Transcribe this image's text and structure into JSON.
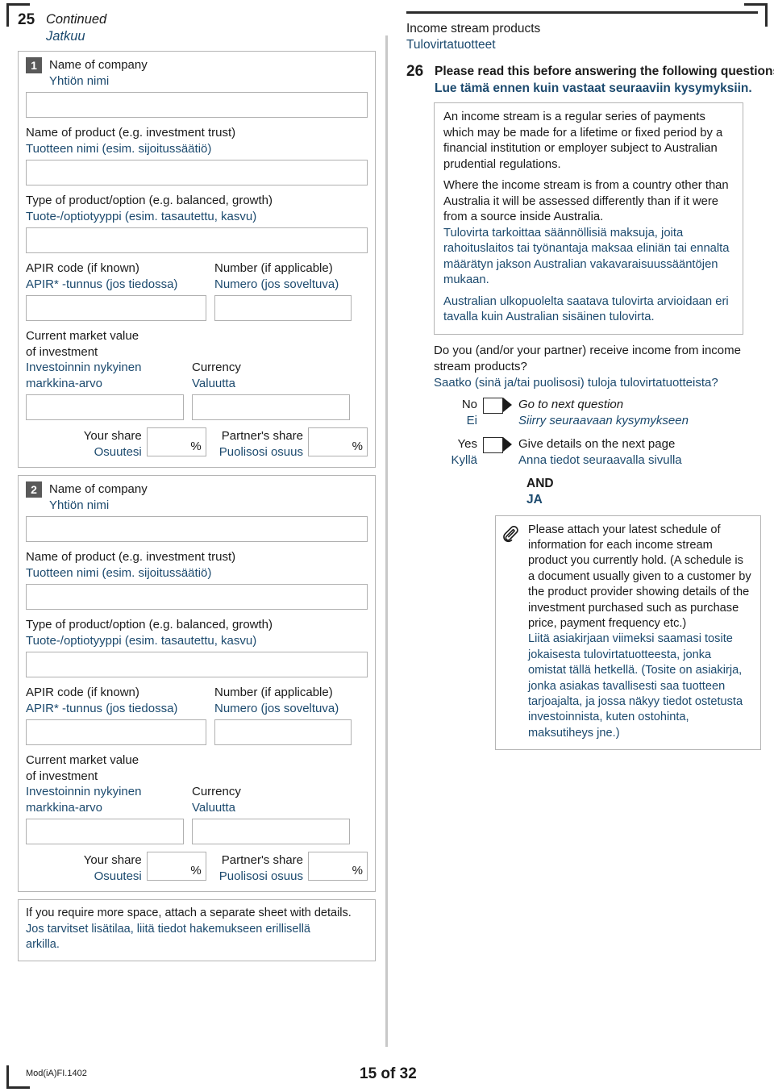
{
  "document": {
    "form_code": "Mod(iA)FI.1402",
    "page_label": "15 of 32",
    "colors": {
      "finnish_text": "#1c4a6e",
      "english_text": "#1a1a1a",
      "badge": "#595959"
    }
  },
  "left_column": {
    "question_number": "25",
    "heading_en": "Continued",
    "heading_fi": "Jatkuu",
    "blocks": [
      {
        "badge": "1",
        "company_en": "Name of company",
        "company_fi": "Yhtiön nimi",
        "product_en": "Name of product (e.g. investment trust)",
        "product_fi": "Tuotteen nimi (esim. sijoitussäätiö)",
        "type_en": "Type of product/option (e.g. balanced, growth)",
        "type_fi": "Tuote-/optiotyyppi (esim. tasautettu, kasvu)",
        "apir_en": "APIR code (if known)",
        "apir_fi": "APIR* -tunnus (jos tiedossa)",
        "number_en": "Number (if applicable)",
        "number_fi": "Numero (jos soveltuva)",
        "value_en_1": "Current market value",
        "value_en_2": "of investment",
        "value_fi_1": "Investoinnin nykyinen",
        "value_fi_2": "markkina-arvo",
        "currency_en": "Currency",
        "currency_fi": "Valuutta",
        "your_share_en": "Your share",
        "your_share_fi": "Osuutesi",
        "partner_share_en": "Partner's share",
        "partner_share_fi": "Puolisosi osuus",
        "percent_symbol": "%"
      },
      {
        "badge": "2",
        "company_en": "Name of company",
        "company_fi": "Yhtiön nimi",
        "product_en": "Name of product (e.g. investment trust)",
        "product_fi": "Tuotteen nimi (esim. sijoitussäätiö)",
        "type_en": "Type of product/option (e.g. balanced, growth)",
        "type_fi": "Tuote-/optiotyyppi (esim. tasautettu, kasvu)",
        "apir_en": "APIR code (if known)",
        "apir_fi": "APIR* -tunnus (jos tiedossa)",
        "number_en": "Number (if applicable)",
        "number_fi": "Numero (jos soveltuva)",
        "value_en_1": "Current market value",
        "value_en_2": "of investment",
        "value_fi_1": "Investoinnin nykyinen",
        "value_fi_2": "markkina-arvo",
        "currency_en": "Currency",
        "currency_fi": "Valuutta",
        "your_share_en": "Your share",
        "your_share_fi": "Osuutesi",
        "partner_share_en": "Partner's share",
        "partner_share_fi": "Puolisosi osuus",
        "percent_symbol": "%"
      }
    ],
    "more_space_note": {
      "en": "If you require more space, attach a separate sheet with details.",
      "fi_line1": "Jos tarvitset lisätilaa, liitä tiedot hakemukseen erillisellä",
      "fi_line2": "arkilla."
    }
  },
  "right_column": {
    "section_title_en": "Income stream products",
    "section_title_fi": "Tulovirtatuotteet",
    "question_number": "26",
    "question_en": "Please read this before answering the following questions.",
    "question_fi": "Lue tämä ennen kuin vastaat seuraaviin kysymyksiin.",
    "info_paragraphs": [
      {
        "lang": "en",
        "text": "An income stream is a regular series of payments which may be made for a lifetime or fixed period by a financial institution or employer subject to Australian prudential regulations."
      },
      {
        "lang": "en",
        "text": "Where the income stream is from a country other than Australia it will be assessed differently than if it were from a source inside Australia."
      },
      {
        "lang": "fi",
        "text": "Tulovirta tarkoittaa säännöllisiä maksuja, joita rahoituslaitos tai työnantaja maksaa eliniän tai ennalta määrätyn jakson Australian vakavaraisuussääntöjen mukaan."
      },
      {
        "lang": "fi",
        "text": "Australian ulkopuolelta saatava tulovirta arvioidaan eri tavalla kuin Australian sisäinen tulovirta."
      }
    ],
    "main_question_en_line1": "Do you (and/or your partner) receive income from income",
    "main_question_en_line2": "stream products?",
    "main_question_fi": "Saatko (sinä ja/tai puolisosi) tuloja tulovirtatuotteista?",
    "answers": [
      {
        "label_en": "No",
        "label_fi": "Ei",
        "action_en": "Go to next question",
        "action_fi": "Siirry seuraavaan kysymykseen",
        "italic": true
      },
      {
        "label_en": "Yes",
        "label_fi": "Kyllä",
        "action_en": "Give details on the next page",
        "action_fi": "Anna tiedot seuraavalla sivulla",
        "italic": false
      }
    ],
    "and_en": "AND",
    "and_fi": "JA",
    "attachment": {
      "icon": "paperclip-icon",
      "en": "Please attach your latest schedule of information for each income stream product you currently hold. (A schedule is a document usually given to a customer by the product provider showing details of the investment purchased such as purchase price, payment frequency etc.)",
      "fi": "Liitä asiakirjaan viimeksi saamasi tosite jokaisesta tulovirtatuotteesta, jonka omistat tällä hetkellä. (Tosite on asiakirja, jonka asiakas tavallisesti saa tuotteen tarjoajalta, ja jossa näkyy tiedot ostetusta investoinnista, kuten ostohinta, maksutiheys jne.)"
    }
  }
}
